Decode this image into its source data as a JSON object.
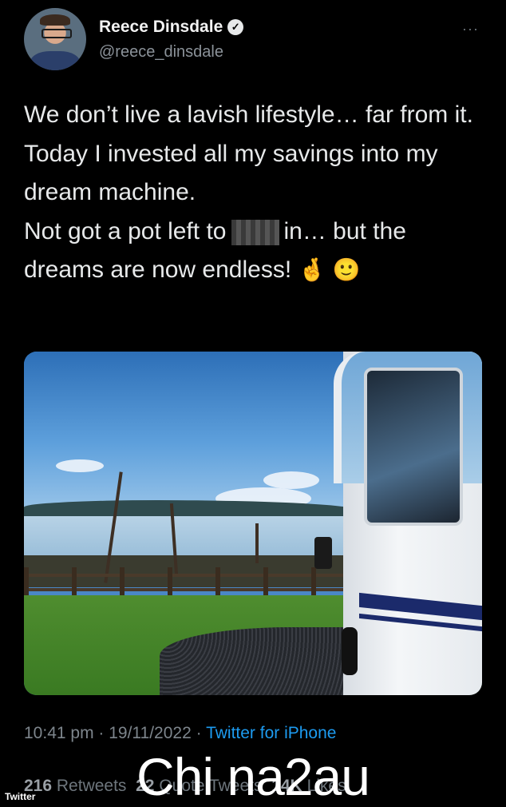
{
  "header": {
    "display_name": "Reece Dinsdale",
    "verified_symbol": "✓",
    "handle": "@reece_dinsdale",
    "more_icon": "···"
  },
  "tweet": {
    "line1": "We don’t live a lavish lifestyle… far from it.",
    "line2": "Today I invested all my savings into my dream machine.",
    "line3_before": "Not got a pot left to",
    "line3_after": "in… but the dreams are now endless!",
    "emoji1": "🤞",
    "emoji2": "🙂"
  },
  "meta": {
    "time_date": "10:41 pm · 19/11/2022 ·",
    "source": "Twitter for iPhone"
  },
  "stats": {
    "retweets_count": "216",
    "retweets_label": "Retweets",
    "quotes_count": "22",
    "quotes_label": "Quote Tweets",
    "likes_count": "14K",
    "likes_label": "Likes"
  },
  "watermark": "Chi na2au",
  "credit": "Twitter"
}
